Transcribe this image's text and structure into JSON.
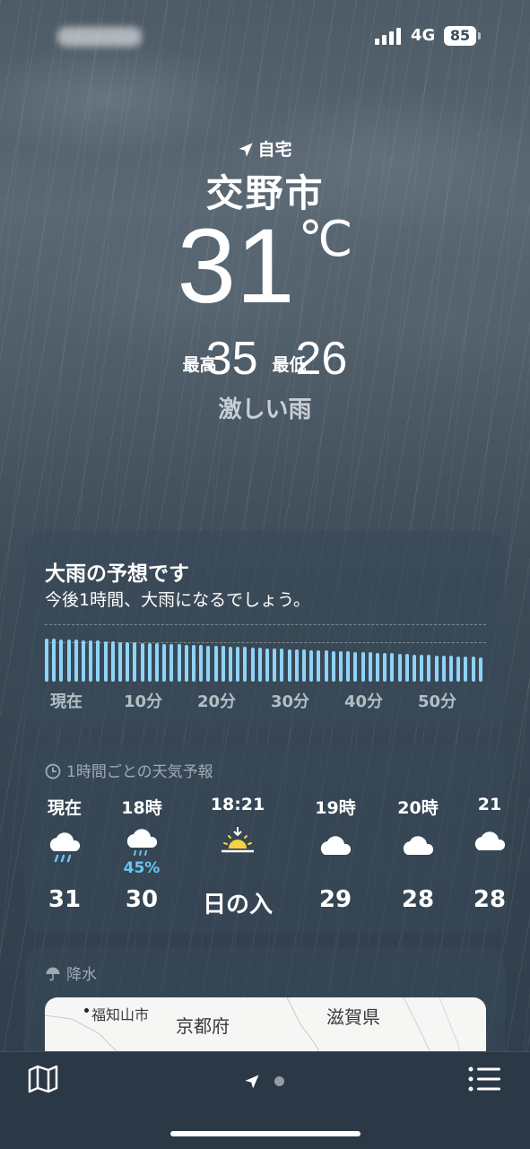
{
  "status_bar": {
    "network": "4G",
    "battery": "85"
  },
  "location": {
    "label": "自宅",
    "city": "交野市"
  },
  "current": {
    "temperature": "31",
    "unit": "℃",
    "high_label": "最高",
    "high": "35",
    "low_label": "最低",
    "low": "26",
    "condition": "激しい雨"
  },
  "precip_card": {
    "title": "大雨の予想です",
    "subtitle": "今後1時間、大雨になるでしょう。",
    "axis": [
      "現在",
      "10分",
      "20分",
      "30分",
      "40分",
      "50分"
    ],
    "intensity_bar_count": 60,
    "bar_color": "#8fd3f7"
  },
  "hourly_card": {
    "title": "1時間ごとの天気予報",
    "hours": [
      {
        "time": "現在",
        "icon": "rain-cloud-icon",
        "pop": "",
        "value": "31"
      },
      {
        "time": "18時",
        "icon": "drizzle-cloud-icon",
        "pop": "45%",
        "value": "30"
      },
      {
        "time": "18:21",
        "icon": "sunset-icon",
        "pop": "",
        "value": "日の入"
      },
      {
        "time": "19時",
        "icon": "cloud-icon",
        "pop": "",
        "value": "29"
      },
      {
        "time": "20時",
        "icon": "cloud-icon",
        "pop": "",
        "value": "28"
      },
      {
        "time": "21",
        "icon": "cloud-icon",
        "pop": "",
        "value": "28"
      }
    ]
  },
  "precip_map_card": {
    "title": "降水",
    "labels": {
      "a": "福知山市",
      "b": "京都府",
      "c": "滋賀県"
    }
  },
  "colors": {
    "accent_blue": "#65c7f6",
    "bar_blue": "#8fd3f7",
    "sunset_yellow": "#f7d23e"
  }
}
